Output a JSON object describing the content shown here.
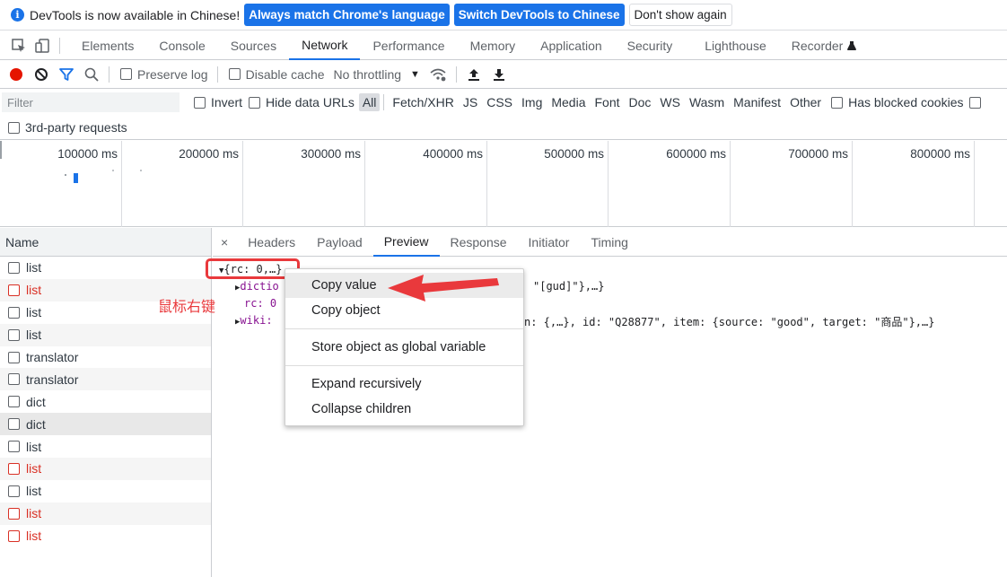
{
  "infobar": {
    "message": "DevTools is now available in Chinese!",
    "btn_match": "Always match Chrome's language",
    "btn_switch": "Switch DevTools to Chinese",
    "btn_dismiss": "Don't show again"
  },
  "main_tabs": [
    "Elements",
    "Console",
    "Sources",
    "Network",
    "Performance",
    "Memory",
    "Application",
    "Security",
    "Lighthouse",
    "Recorder"
  ],
  "active_main_tab": "Network",
  "toolbar": {
    "preserve_log": "Preserve log",
    "disable_cache": "Disable cache",
    "throttling": "No throttling"
  },
  "filter": {
    "placeholder": "Filter",
    "invert": "Invert",
    "hide_data_urls": "Hide data URLs",
    "types": [
      "All",
      "Fetch/XHR",
      "JS",
      "CSS",
      "Img",
      "Media",
      "Font",
      "Doc",
      "WS",
      "Wasm",
      "Manifest",
      "Other"
    ],
    "has_blocked_cookies": "Has blocked cookies",
    "third_party": "3rd-party requests"
  },
  "overview": {
    "ticks": [
      "100000 ms",
      "200000 ms",
      "300000 ms",
      "400000 ms",
      "500000 ms",
      "600000 ms",
      "700000 ms",
      "800000 ms"
    ]
  },
  "requests": {
    "header": "Name",
    "items": [
      {
        "name": "list",
        "failed": false
      },
      {
        "name": "list",
        "failed": true
      },
      {
        "name": "list",
        "failed": false
      },
      {
        "name": "list",
        "failed": false
      },
      {
        "name": "translator",
        "failed": false
      },
      {
        "name": "translator",
        "failed": false
      },
      {
        "name": "dict",
        "failed": false
      },
      {
        "name": "dict",
        "failed": false
      },
      {
        "name": "list",
        "failed": false
      },
      {
        "name": "list",
        "failed": true
      },
      {
        "name": "list",
        "failed": false
      },
      {
        "name": "list",
        "failed": true
      },
      {
        "name": "list",
        "failed": true
      }
    ]
  },
  "detail": {
    "close": "×",
    "tabs": [
      "Headers",
      "Payload",
      "Preview",
      "Response",
      "Initiator",
      "Timing"
    ],
    "active_tab": "Preview",
    "preview": {
      "root": "{rc: 0,…}",
      "dict_key": "dictio",
      "dict_tail": "\"[gud]\"},…}",
      "rc_line": "rc: 0",
      "wiki_key": "wiki:",
      "wiki_tail": "n: {,…}, id: \"Q28877\", item: {source: \"good\", target: \"商品\"},…}"
    }
  },
  "annotation": "鼠标右键",
  "context_menu": {
    "items": [
      "Copy value",
      "Copy object",
      "Store object as global variable",
      "Expand recursively",
      "Collapse children"
    ]
  },
  "colors": {
    "accent": "#1a73e8",
    "error": "#d93025",
    "annotation": "#e9393c"
  }
}
